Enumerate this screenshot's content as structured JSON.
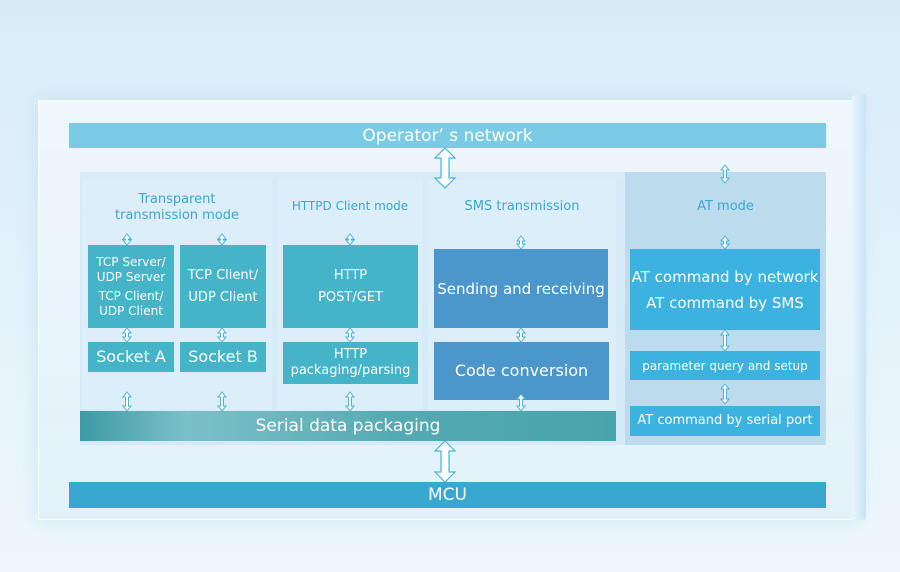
{
  "operator_network": "Operator’ s network",
  "mcu": "MCU",
  "serial_data_packaging": "Serial data packaging",
  "transparent": {
    "title_line1": "Transparent",
    "title_line2": "transmission mode",
    "box_a": [
      "TCP Server/",
      "UDP Server",
      "TCP Client/",
      "UDP Client"
    ],
    "box_b": [
      "TCP Client/",
      "UDP Client"
    ],
    "socket_a": "Socket A",
    "socket_b": "Socket B"
  },
  "httpd": {
    "title": "HTTPD Client mode",
    "post_get": [
      "HTTP",
      "POST/GET"
    ],
    "packaging": [
      "HTTP",
      "packaging/parsing"
    ]
  },
  "sms": {
    "title": "SMS transmission",
    "sending": "Sending and receiving",
    "code": "Code conversion"
  },
  "at": {
    "title": "AT mode",
    "network": [
      "AT command by network",
      "AT command by SMS"
    ],
    "param": "parameter query and setup",
    "serial": "AT command by serial port"
  },
  "colors": {
    "operator_bar": "#7ccbe6",
    "mcu_bar": "#39a8d0",
    "serial_bar": "#4aa6ae",
    "teal_box": "#45b3c8",
    "blue_box": "#4b96cb",
    "sky_box": "#3bb2df"
  }
}
